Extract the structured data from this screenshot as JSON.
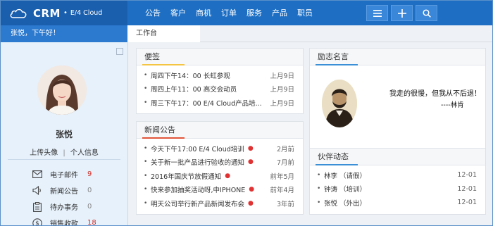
{
  "app": {
    "brand": "CRM",
    "brand_sub": "E/4 Cloud",
    "greeting": "张悦，下午好！"
  },
  "nav": [
    "公告",
    "客户",
    "商机",
    "订单",
    "服务",
    "产品",
    "职员"
  ],
  "tools": [
    "menu-icon",
    "plus-icon",
    "search-icon"
  ],
  "tabs": {
    "active": "工作台"
  },
  "user": {
    "name": "张悦",
    "upload_avatar": "上传头像",
    "profile": "个人信息"
  },
  "sidebar_menu": [
    {
      "icon": "mail-icon",
      "label": "电子邮件",
      "count": "9",
      "count_color": "#d0302a"
    },
    {
      "icon": "speaker-icon",
      "label": "新闻公告",
      "count": "0",
      "count_color": "#888888"
    },
    {
      "icon": "clipboard-icon",
      "label": "待办事务",
      "count": "0",
      "count_color": "#888888"
    },
    {
      "icon": "dollar-icon",
      "label": "销售收款",
      "count": "18",
      "count_color": "#d0302a"
    }
  ],
  "memo": {
    "title": "便签",
    "accent": "#f4c542",
    "items": [
      {
        "text": "周四下午14：00 长虹参观",
        "date": "上月9日"
      },
      {
        "text": "周四上午11：00 高交会动员",
        "date": "上月9日"
      },
      {
        "text": "周三下午17：00 E/4 Cloud产品培...",
        "date": "上月9日"
      }
    ]
  },
  "news": {
    "title": "新闻公告",
    "accent": "#e2553a",
    "items": [
      {
        "text": "今天下午17:00 E/4 Cloud培训",
        "date": "2月前"
      },
      {
        "text": "关于新一批产品进行验收的通知",
        "date": "7月前"
      },
      {
        "text": "2016年国庆节放假通知",
        "date": "前年5月"
      },
      {
        "text": "快来参加抽奖活动呀,中IPHONE",
        "date": "前年4月"
      },
      {
        "text": "明天公司举行新产品新闻发布会",
        "date": "3年前"
      }
    ]
  },
  "motto": {
    "title": "励志名言",
    "accent": "#3a8fd6",
    "quote": "我走的很慢，但我从不后退！",
    "author": "----林肯"
  },
  "partners": {
    "title": "伙伴动态",
    "accent": "#3a8fd6",
    "items": [
      {
        "text": "林李 （请假）",
        "date": "12-01"
      },
      {
        "text": "钟涛 （培训）",
        "date": "12-01"
      },
      {
        "text": "张悦 （外出）",
        "date": "12-01"
      }
    ]
  }
}
